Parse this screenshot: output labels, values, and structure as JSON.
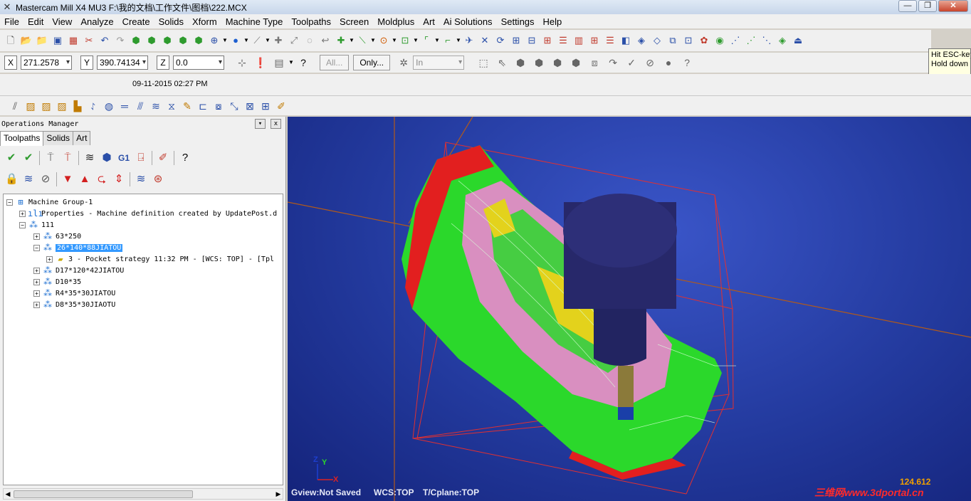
{
  "window": {
    "app_icon": "mastercam-icon",
    "title": "Mastercam Mill X4 MU3  F:\\我的文档\\工作文件\\图档\\222.MCX",
    "buttons": [
      "—",
      "❐",
      "✕"
    ]
  },
  "menu": [
    "File",
    "Edit",
    "View",
    "Analyze",
    "Create",
    "Solids",
    "Xform",
    "Machine Type",
    "Toolpaths",
    "Screen",
    "Moldplus",
    "Art",
    "Ai Solutions",
    "Settings",
    "Help"
  ],
  "toolbar_main_icons": [
    "new-file-icon",
    "open-file-icon",
    "edit-file-icon",
    "save-icon",
    "print-icon",
    "cut-icon",
    "undo-icon",
    "redo-icon",
    "box-icon",
    "solid-icon",
    "block-icon",
    "cube-icon",
    "prism-icon",
    "sphere-icon",
    "shade-icon",
    "line-icon",
    "point-icon",
    "arc-icon",
    "move-icon",
    "chamfer-icon",
    "circle-icon",
    "rect-icon",
    "spline-icon",
    "corner-icon",
    "analyze-icon",
    "grid-icon",
    "layer-icon",
    "mesh-icon",
    "toolpath-icon",
    "verify-icon"
  ],
  "tooltip": {
    "line1": "Hit ESC-key",
    "line2": "Hold down S"
  },
  "coords": {
    "x_label": "X",
    "x_value": "271.2578",
    "y_label": "Y",
    "y_value": "390.74134",
    "z_label": "Z",
    "z_value": "0.0"
  },
  "general_selection": {
    "all_label": "All...",
    "only_label": "Only...",
    "plane_value": "In"
  },
  "date": "09-11-2015 02:27 PM",
  "toolbar_toolpath_icons": [
    "contour-icon",
    "drill-icon",
    "pocket-icon",
    "face-icon",
    "slot-icon",
    "surface-rough-icon",
    "surface-finish-icon",
    "flowline-icon",
    "parallel-icon",
    "scallop-icon",
    "pencil-icon",
    "project-icon",
    "waterline-icon",
    "restmill-icon",
    "blend-icon",
    "hybrid-icon",
    "multiaxis-icon",
    "transform-icon",
    "nesting-icon",
    "magic-icon"
  ],
  "ops_manager": {
    "title": "Operations Manager",
    "pin": "▾",
    "close": "x",
    "tabs": [
      "Toolpaths",
      "Solids",
      "Art"
    ],
    "tools_row1": [
      "select-all-icon",
      "regen-icon",
      "regen-dirty-icon",
      "backplot-icon",
      "verify-icon",
      "simulate-icon",
      "post-icon",
      "highfeed-icon",
      "delete-icon",
      "help-icon"
    ],
    "tools_row2": [
      "lock-icon",
      "toggle-display-icon",
      "toggle-post-icon",
      "move-down-icon",
      "move-up-icon",
      "insert-arrow-icon",
      "scroll-icon",
      "single-display-icon",
      "expand-icon"
    ],
    "tree": [
      {
        "label": "Machine Group-1",
        "icon": "machine-group-icon",
        "expander": "−"
      },
      {
        "label": "Properties - Machine definition created by UpdatePost.d",
        "icon": "properties-icon",
        "expander": "+"
      },
      {
        "label": "111",
        "icon": "toolpath-group-icon",
        "expander": "−"
      },
      {
        "label": "63*250",
        "icon": "toolpath-group-icon",
        "expander": "+"
      },
      {
        "label": "26*140*88JIATOU",
        "icon": "toolpath-group-icon",
        "expander": "−",
        "selected": true
      },
      {
        "label": "3 - Pocket strategy 11:32 PM - [WCS: TOP] - [Tpl",
        "icon": "operation-folder-icon",
        "expander": "+"
      },
      {
        "label": "D17*120*42JIATOU",
        "icon": "toolpath-group-icon",
        "expander": "+"
      },
      {
        "label": "D10*35",
        "icon": "toolpath-group-icon",
        "expander": "+"
      },
      {
        "label": "R4*35*30JIATOU",
        "icon": "toolpath-group-icon",
        "expander": "+"
      },
      {
        "label": "D8*35*30JIAOTU",
        "icon": "toolpath-group-icon",
        "expander": "+"
      }
    ]
  },
  "viewport": {
    "gview": "Gview:Not Saved",
    "wcs": "WCS:TOP",
    "tcplane": "T/Cplane:TOP",
    "zoom": "124.612",
    "watermark": "三维网www.3dportal.cn",
    "axis_z": "Z",
    "axis_y": "Y",
    "axis_x": "X",
    "colors": {
      "background": "#233a9e",
      "part_green": "#2bd82b",
      "part_pink": "#d98fc0",
      "part_yellow": "#e3d21c",
      "part_red": "#e21f1f",
      "tool": "#27286a",
      "bounding_box": "#e23030",
      "axis_line": "#b25a1a"
    }
  }
}
